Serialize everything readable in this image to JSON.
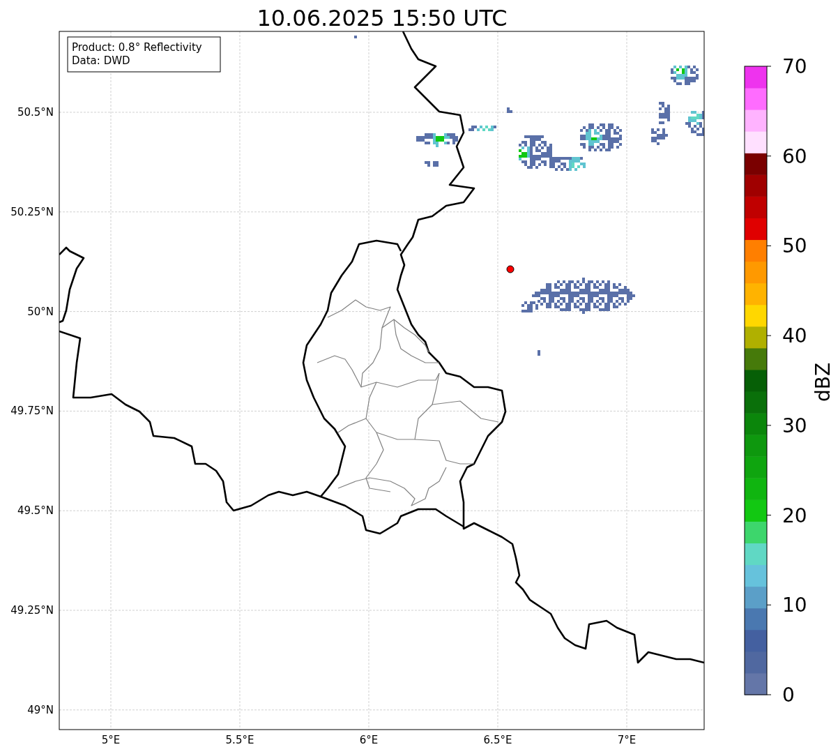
{
  "title": "10.06.2025 15:50 UTC",
  "info_box": [
    "Product: 0.8° Reflectivity",
    "Data: DWD"
  ],
  "x_axis": {
    "ticks": [
      "5°E",
      "5.5°E",
      "6°E",
      "6.5°E",
      "7°E"
    ]
  },
  "y_axis": {
    "ticks": [
      "50.5°N",
      "50.25°N",
      "50°N",
      "49.75°N",
      "49.5°N",
      "49.25°N",
      "49°N"
    ]
  },
  "colorbar": {
    "label": "dBZ",
    "ticks": [
      "70",
      "60",
      "50",
      "40",
      "30",
      "20",
      "10",
      "0"
    ],
    "bands": [
      {
        "color": "#6476a8"
      },
      {
        "color": "#5068a0"
      },
      {
        "color": "#4460a0"
      },
      {
        "color": "#4a78b0"
      },
      {
        "color": "#5b9fc8"
      },
      {
        "color": "#66c2dc"
      },
      {
        "color": "#60d8c4"
      },
      {
        "color": "#3dd66c"
      },
      {
        "color": "#12c812"
      },
      {
        "color": "#10b510"
      },
      {
        "color": "#0fa50f"
      },
      {
        "color": "#0e980e"
      },
      {
        "color": "#0b860b"
      },
      {
        "color": "#0a700a"
      },
      {
        "color": "#065f06"
      },
      {
        "color": "#467a0a"
      },
      {
        "color": "#b0b000"
      },
      {
        "color": "#ffd700"
      },
      {
        "color": "#ffb300"
      },
      {
        "color": "#ff9900"
      },
      {
        "color": "#ff7f00"
      },
      {
        "color": "#e00000"
      },
      {
        "color": "#c00000"
      },
      {
        "color": "#a00000"
      },
      {
        "color": "#7a0000"
      },
      {
        "color": "#ffe0ff"
      },
      {
        "color": "#ffb3ff"
      },
      {
        "color": "#ff6cff"
      },
      {
        "color": "#ee33ee"
      }
    ]
  }
}
